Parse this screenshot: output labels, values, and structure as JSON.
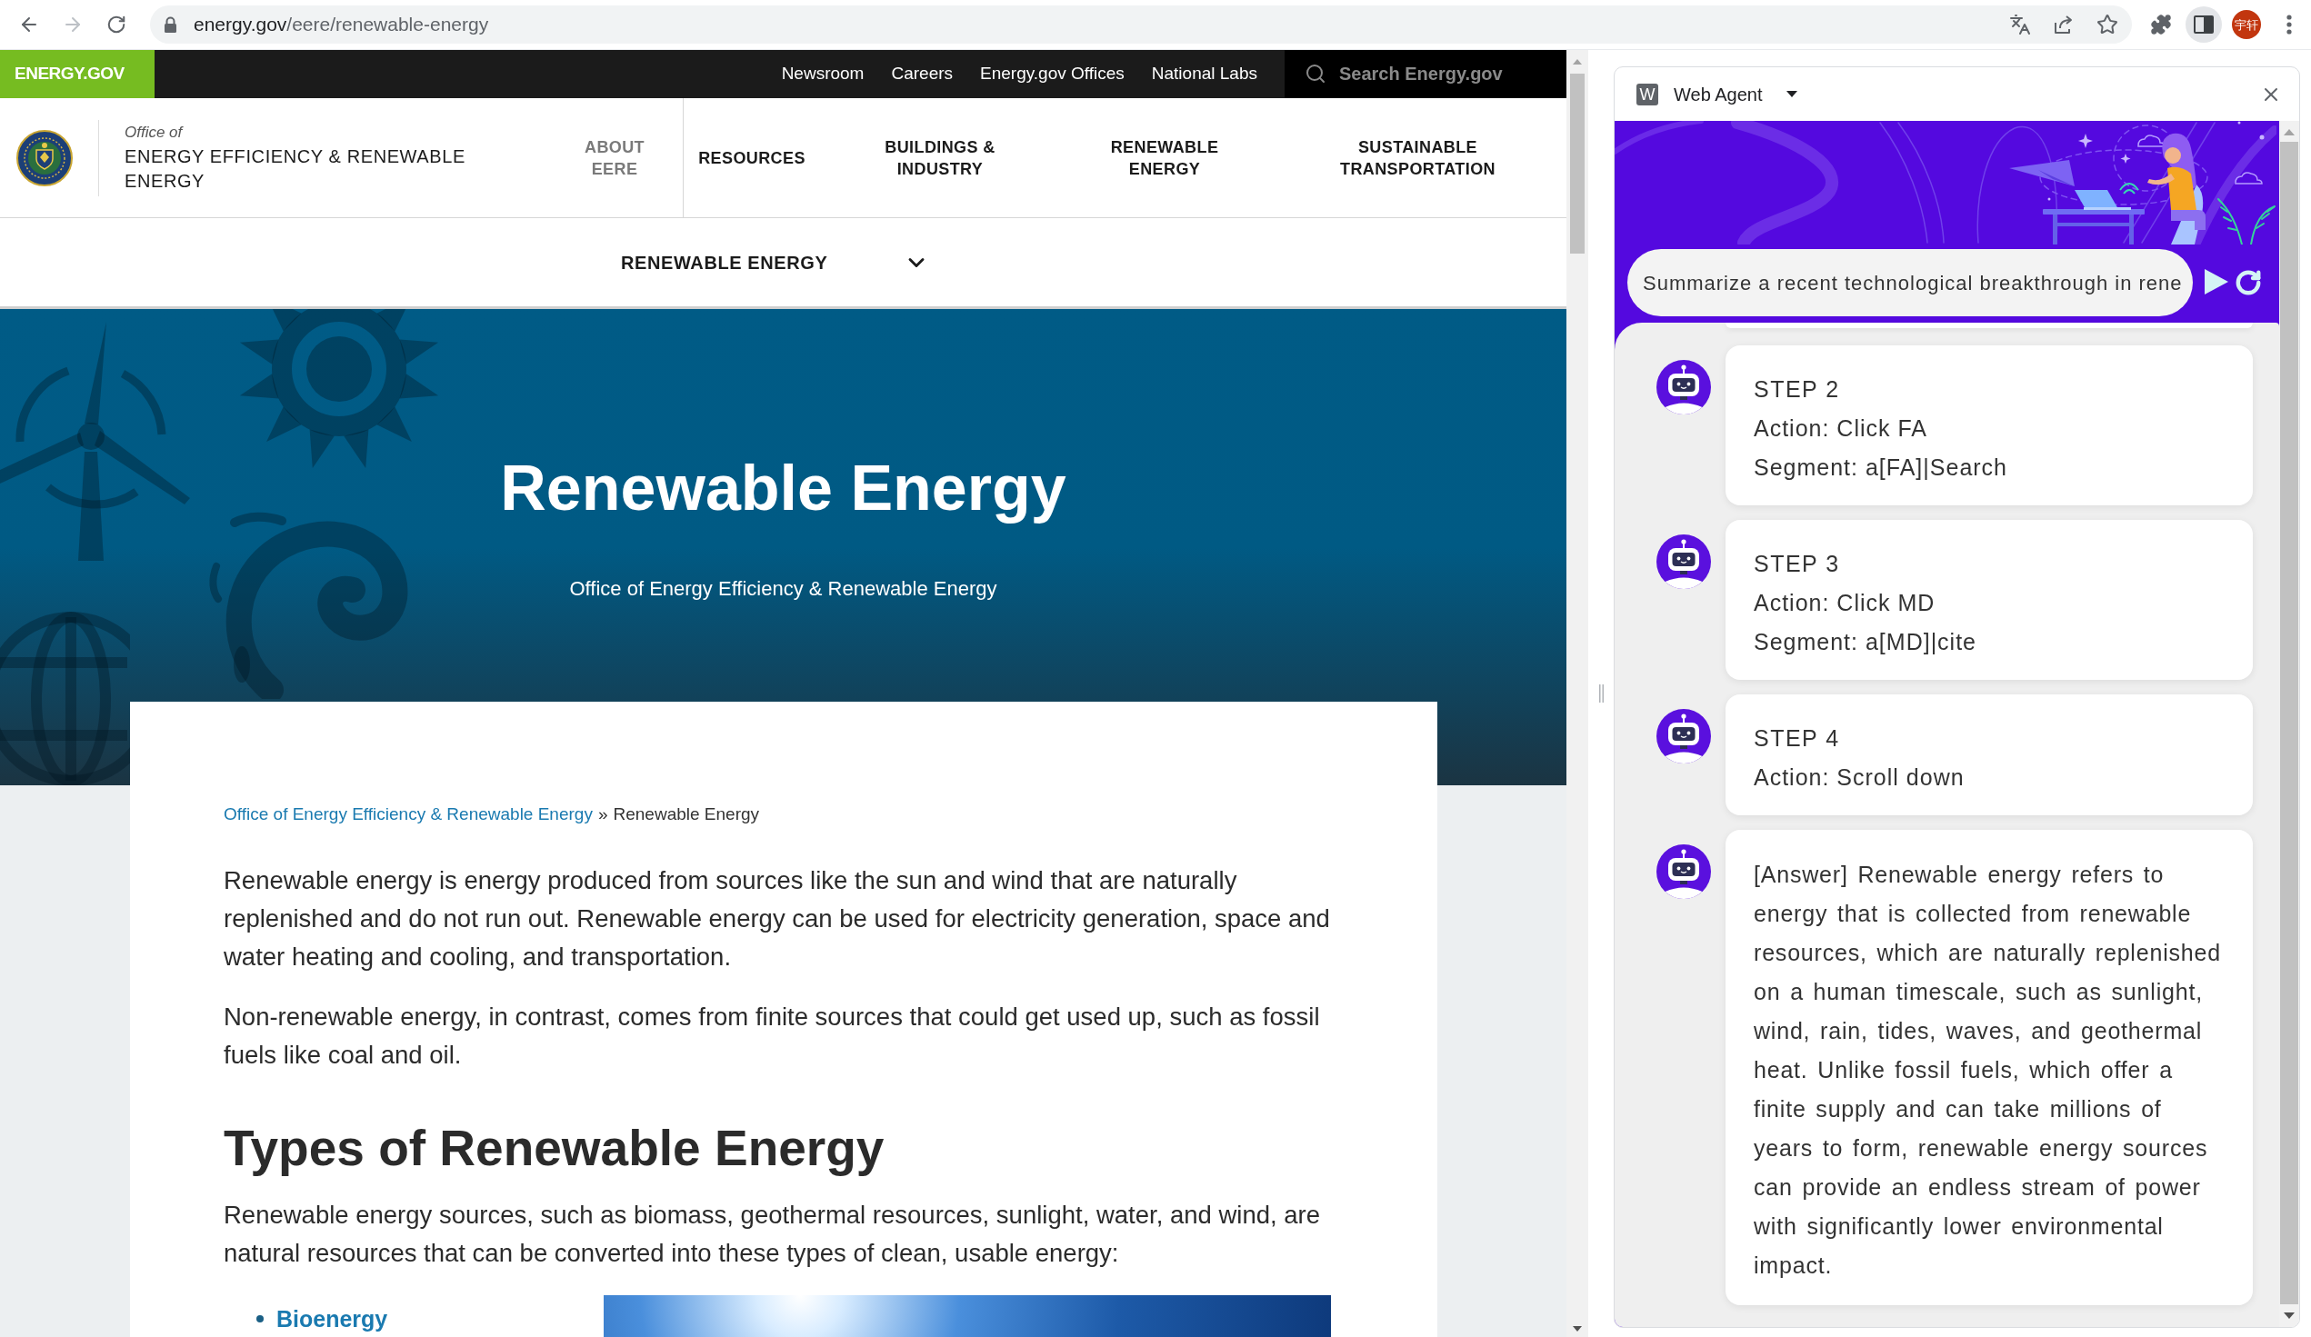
{
  "browser": {
    "url_host": "energy.gov",
    "url_path": "/eere/renewable-energy",
    "forward_enabled": false,
    "side_panel_open": true,
    "profile_initials": "宇轩"
  },
  "site": {
    "top_bar": {
      "brand": "ENERGY.GOV",
      "links": [
        "Newsroom",
        "Careers",
        "Energy.gov Offices",
        "National Labs"
      ],
      "search": {
        "placeholder": "Search Energy.gov"
      }
    },
    "header": {
      "office_prefix": "Office of",
      "office_name": "ENERGY EFFICIENCY & RENEWABLE ENERGY",
      "nav": [
        {
          "label": "ABOUT EERE",
          "muted": true
        },
        {
          "label": "RESOURCES",
          "muted": false
        },
        {
          "label": "BUILDINGS & INDUSTRY",
          "muted": false
        },
        {
          "label": "RENEWABLE ENERGY",
          "muted": false
        },
        {
          "label": "SUSTAINABLE TRANSPORTATION",
          "muted": false
        }
      ]
    },
    "subnav": {
      "label": "RENEWABLE ENERGY",
      "expanded": false
    },
    "hero": {
      "title": "Renewable Energy",
      "subtitle": "Office of Energy Efficiency & Renewable Energy"
    },
    "breadcrumb": {
      "items": [
        {
          "kind": "link",
          "label": "Office of Energy Efficiency & Renewable Energy"
        },
        {
          "kind": "current",
          "label": "Renewable Energy"
        }
      ],
      "separator": "»"
    },
    "body": [
      {
        "kind": "paragraph",
        "text": "Renewable energy is energy produced from sources like the sun and wind that are naturally replenished and do not run out. Renewable energy can be used for electricity generation, space and water heating and cooling, and transportation."
      },
      {
        "kind": "paragraph",
        "text": "Non-renewable energy, in contrast, comes from finite sources that could get used up, such as fossil fuels like coal and oil."
      },
      {
        "kind": "heading",
        "text": "Types of Renewable Energy"
      },
      {
        "kind": "paragraph",
        "text": "Renewable energy sources, such as biomass, geothermal resources, sunlight, water, and wind, are natural resources that can be converted into these types of clean, usable energy:"
      }
    ],
    "list": [
      {
        "label": "Bioenergy"
      }
    ]
  },
  "agent": {
    "icon_letter": "W",
    "title": "Web Agent",
    "prompt": {
      "value": "Summarize a recent technological breakthrough in rene"
    },
    "messages": [
      {
        "kind": "step",
        "title": "STEP 2",
        "lines": [
          "Action: Click FA",
          "Segment: a[FA]|Search"
        ]
      },
      {
        "kind": "step",
        "title": "STEP 3",
        "lines": [
          "Action: Click MD",
          "Segment: a[MD]|cite"
        ]
      },
      {
        "kind": "step",
        "title": "STEP 4",
        "lines": [
          "Action: Scroll down"
        ]
      },
      {
        "kind": "answer",
        "text": "[Answer] Renewable energy refers to energy that is collected from renewable resources, which are naturally replenished on a human timescale, such as sunlight, wind, rain, tides, waves, and geothermal heat. Unlike fossil fuels, which offer a finite supply and can take millions of years to form, renewable energy sources can provide an endless stream of power with significantly lower environmental impact."
      }
    ]
  }
}
